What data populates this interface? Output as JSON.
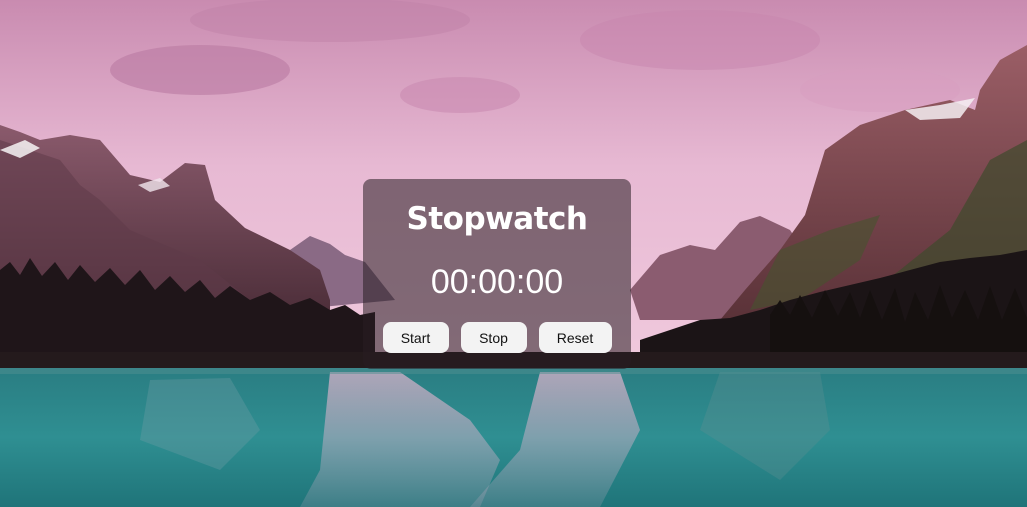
{
  "stopwatch": {
    "title": "Stopwatch",
    "time": "00:00:00",
    "buttons": {
      "start": "Start",
      "stop": "Stop",
      "reset": "Reset"
    }
  },
  "background": {
    "description_colors": {
      "sky": "#d9a6c4",
      "mountains": "#6e4350",
      "trees": "#1d1418",
      "water": "#1f8a8c"
    }
  }
}
